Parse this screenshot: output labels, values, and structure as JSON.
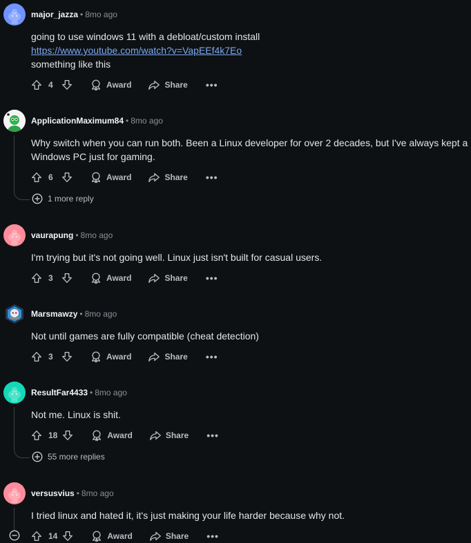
{
  "labels": {
    "award": "Award",
    "share": "Share",
    "more": "•••"
  },
  "comments": [
    {
      "author": "major_jazza",
      "time": "8mo ago",
      "lines": [
        "going to use windows 11 with a debloat/custom install"
      ],
      "link": "https://www.youtube.com/watch?v=VapEEf4k7Eo",
      "after_link": "something like this",
      "votes": "4",
      "avatar_color": "#7193ff"
    },
    {
      "author": "ApplicationMaximum84",
      "time": "8mo ago",
      "text": "Why switch when you can run both. Been a Linux developer for over 2 decades, but I've always kept a Windows PC just for gaming.",
      "votes": "6",
      "more_replies": "1 more reply",
      "avatar_color": "#ffffff"
    },
    {
      "author": "vaurapung",
      "time": "8mo ago",
      "text": "I'm trying but it's not going well. Linux just isn't built for casual users.",
      "votes": "3",
      "avatar_color": "#ff8c9c"
    },
    {
      "author": "Marsmawzy",
      "time": "8mo ago",
      "text": "Not until games are fully compatible (cheat detection)",
      "votes": "3",
      "avatar_color": "#2f6f9e"
    },
    {
      "author": "ResultFar4433",
      "time": "8mo ago",
      "text": "Not me. Linux is shit.",
      "votes": "18",
      "more_replies": "55 more replies",
      "avatar_color": "#14d9b8"
    },
    {
      "author": "versusvius",
      "time": "8mo ago",
      "text": "I tried linux and hated it, it's just making your life harder because why not.",
      "votes": "14",
      "avatar_color": "#ff8c9c"
    }
  ]
}
